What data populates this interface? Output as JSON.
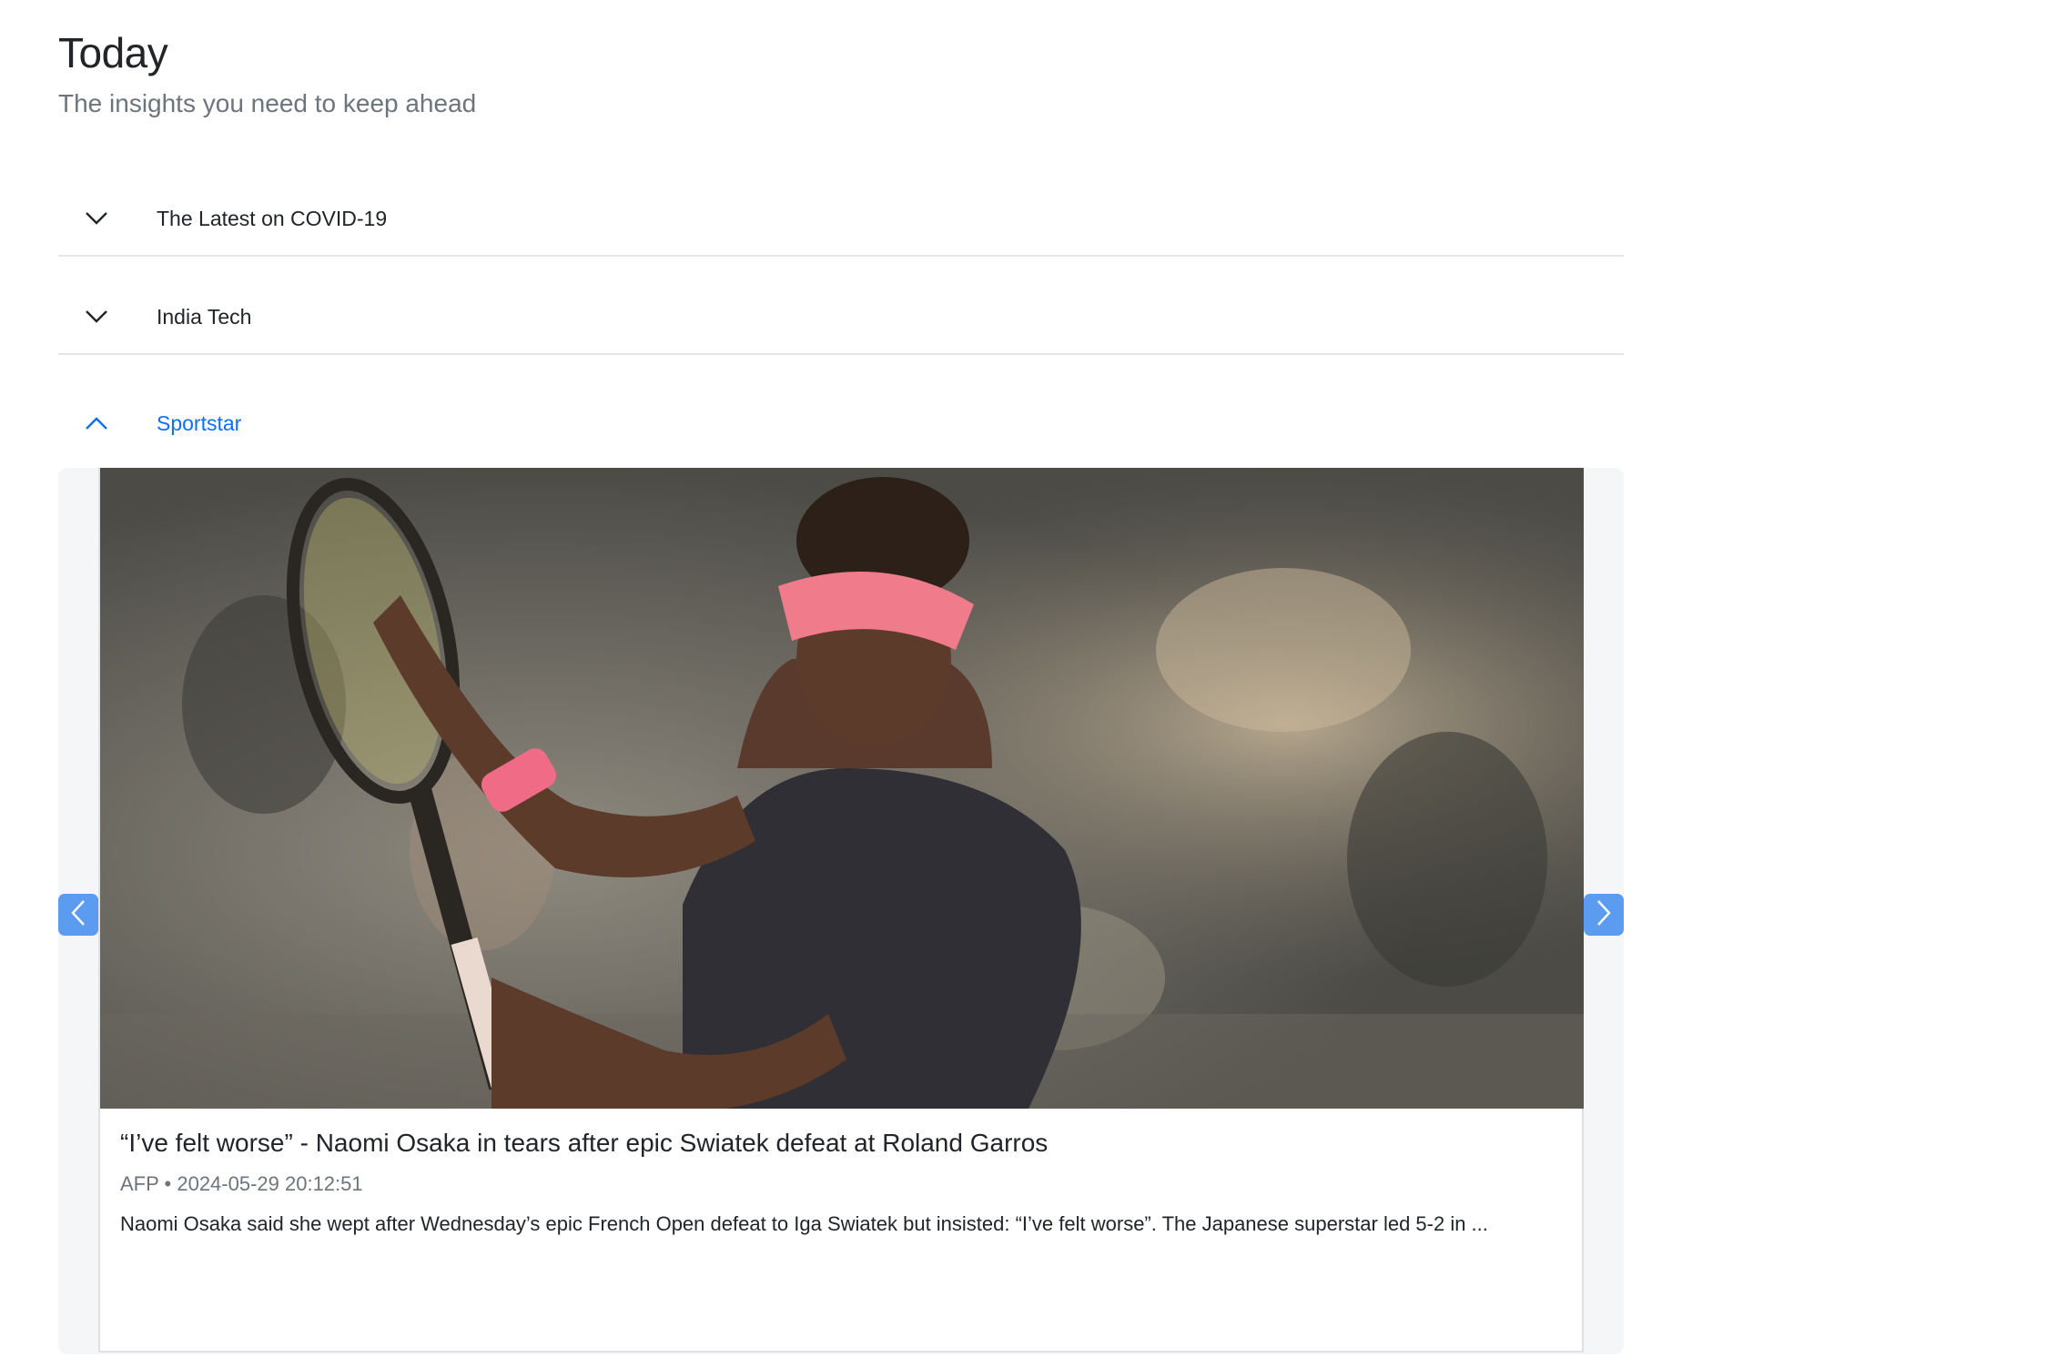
{
  "header": {
    "title": "Today",
    "subtitle": "The insights you need to keep ahead"
  },
  "accordion": [
    {
      "label": "The Latest on COVID-19",
      "expanded": false,
      "icon": "chevron-down-icon"
    },
    {
      "label": "India Tech",
      "expanded": false,
      "icon": "chevron-down-icon"
    },
    {
      "label": "Sportstar",
      "expanded": true,
      "icon": "chevron-up-icon"
    }
  ],
  "carousel": {
    "prev_icon": "chevron-left-icon",
    "next_icon": "chevron-right-icon",
    "button_color": "#5b9bf0",
    "article": {
      "image_alt": "Tennis player with racket wearing pink visor",
      "title": "“I’ve felt worse” - Naomi Osaka in tears after epic Swiatek defeat at Roland Garros",
      "source": "AFP",
      "separator": "•",
      "timestamp": "2024-05-29 20:12:51",
      "description": "Naomi Osaka said she wept after Wednesday’s epic French Open defeat to Iga Swiatek but insisted: “I’ve felt worse”. The Japanese superstar led 5-2 in ..."
    }
  },
  "colors": {
    "accent": "#0d6efd",
    "muted": "#6c757d",
    "text": "#212529",
    "divider": "#e3e6ea"
  }
}
